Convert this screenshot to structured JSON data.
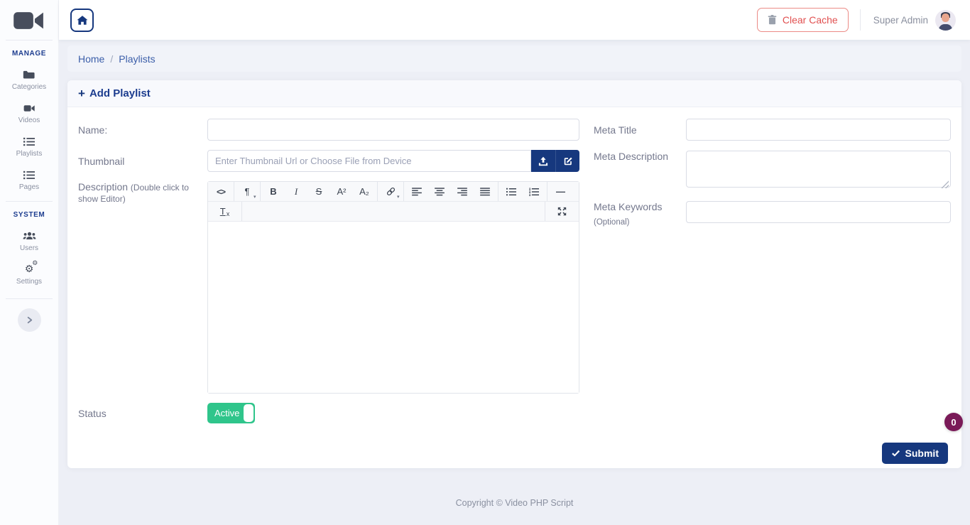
{
  "sidebar": {
    "sections": [
      {
        "label": "MANAGE",
        "items": [
          {
            "label": "Categories",
            "icon": "folder-icon"
          },
          {
            "label": "Videos",
            "icon": "video-camera-icon"
          },
          {
            "label": "Playlists",
            "icon": "list-icon"
          },
          {
            "label": "Pages",
            "icon": "list-icon"
          }
        ]
      },
      {
        "label": "SYSTEM",
        "items": [
          {
            "label": "Users",
            "icon": "users-icon"
          },
          {
            "label": "Settings",
            "icon": "gears-icon"
          }
        ]
      }
    ]
  },
  "topbar": {
    "clear_cache_label": "Clear Cache",
    "user_name": "Super Admin"
  },
  "breadcrumb": {
    "home": "Home",
    "separator": "/",
    "current": "Playlists"
  },
  "form": {
    "title": "Add Playlist",
    "title_icon": "+",
    "fields": {
      "name_label": "Name:",
      "thumbnail_label": "Thumbnail",
      "thumbnail_placeholder": "Enter Thumbnail Url or Choose File from Device",
      "description_label": "Description",
      "description_hint": "(Double click to show Editor)",
      "status_label": "Status",
      "status_value": "Active",
      "meta_title_label": "Meta Title",
      "meta_description_label": "Meta Description",
      "meta_keywords_label": "Meta Keywords",
      "meta_keywords_hint": "(Optional)"
    },
    "submit_label": "Submit"
  },
  "editor": {
    "glyphs": {
      "view_html": "<>",
      "formatting": "¶",
      "caret": "▾",
      "bold": "B",
      "italic": "I",
      "strikethrough": "S",
      "superscript": "A²",
      "subscript": "A₂",
      "horizontal_rule": "—",
      "remove_format_t": "T",
      "remove_format_x": "x"
    }
  },
  "badge": {
    "value": "0"
  },
  "footer": {
    "copyright": "Copyright © Video PHP Script"
  },
  "colors": {
    "primary_navy": "#16387e",
    "link_blue": "#3b5ea9",
    "danger_red": "#e15050",
    "success_green": "#2fc58b",
    "badge_maroon": "#7a1a58",
    "page_background": "#edeff6"
  }
}
